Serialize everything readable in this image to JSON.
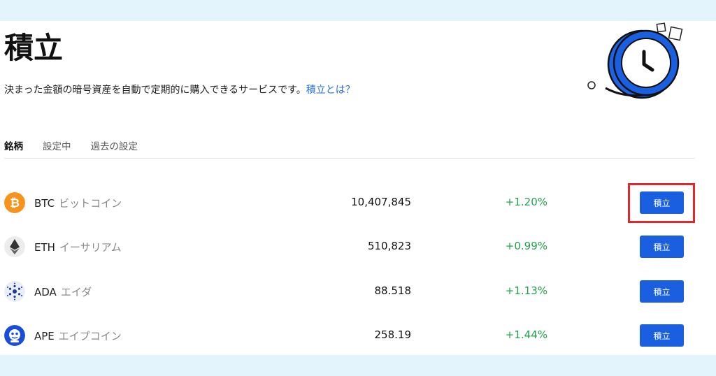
{
  "header": {
    "title": "積立",
    "description": "決まった金額の暗号資産を自動で定期的に購入できるサービスです。",
    "link": "積立とは？"
  },
  "tabs": [
    {
      "label": "銘柄",
      "active": true
    },
    {
      "label": "設定中",
      "active": false
    },
    {
      "label": "過去の設定",
      "active": false
    }
  ],
  "coins": [
    {
      "symbol": "BTC",
      "name": "ビットコイン",
      "price": "10,407,845",
      "change": "+1.20%",
      "button": "積立",
      "icon": "bitcoin-icon",
      "color": "#f7931a"
    },
    {
      "symbol": "ETH",
      "name": "イーサリアム",
      "price": "510,823",
      "change": "+0.99%",
      "button": "積立",
      "icon": "ethereum-icon",
      "color": "#ececec"
    },
    {
      "symbol": "ADA",
      "name": "エイダ",
      "price": "88.518",
      "change": "+1.13%",
      "button": "積立",
      "icon": "cardano-icon",
      "color": "#e9eef8"
    },
    {
      "symbol": "APE",
      "name": "エイプコイン",
      "price": "258.19",
      "change": "+1.44%",
      "button": "積立",
      "icon": "apecoin-icon",
      "color": "#1a4ed8"
    }
  ],
  "colors": {
    "accent": "#1a5fe0",
    "positive": "#22a04b",
    "highlight": "#e0282e"
  }
}
